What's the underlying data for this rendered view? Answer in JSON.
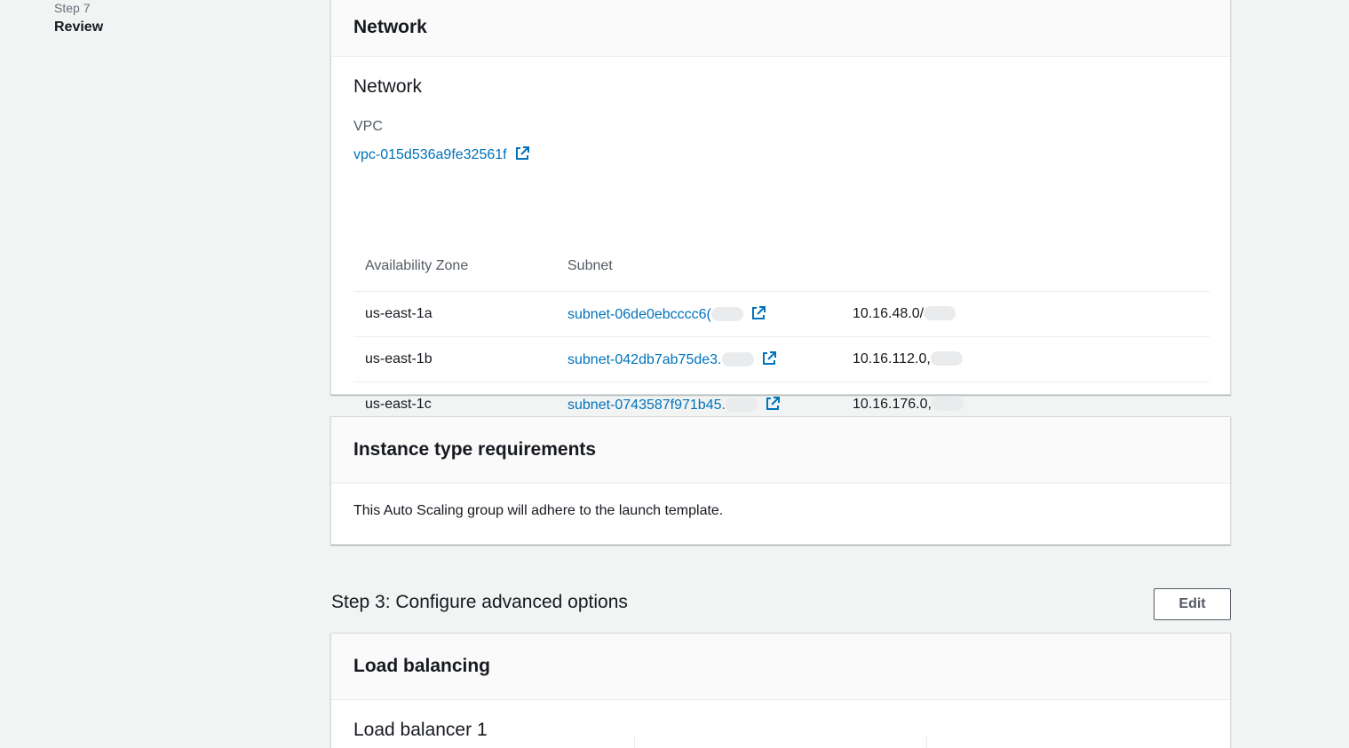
{
  "steps_nav": {
    "step_number": "Step 7",
    "step_title": "Review"
  },
  "network_card": {
    "header": "Network",
    "subheading": "Network",
    "vpc_label": "VPC",
    "vpc_link": "vpc-015d536a9fe32561f",
    "table": {
      "columns": [
        "Availability Zone",
        "Subnet"
      ],
      "rows": [
        {
          "az": "us-east-1a",
          "subnet": "subnet-06de0ebcccc6(",
          "cidr": "10.16.48.0/"
        },
        {
          "az": "us-east-1b",
          "subnet": "subnet-042db7ab75de3.",
          "cidr": "10.16.112.0,"
        },
        {
          "az": "us-east-1c",
          "subnet": "subnet-0743587f971b45.",
          "cidr": "10.16.176.0,"
        }
      ]
    }
  },
  "instance_card": {
    "header": "Instance type requirements",
    "body": "This Auto Scaling group will adhere to the launch template."
  },
  "step3": {
    "title": "Step 3: Configure advanced options",
    "edit_label": "Edit"
  },
  "lb_card": {
    "header": "Load balancing",
    "subheading": "Load balancer 1"
  },
  "colors": {
    "link": "#0073bb",
    "background": "#f2f3f3"
  },
  "icons": {
    "external_link": "external-link-icon"
  }
}
